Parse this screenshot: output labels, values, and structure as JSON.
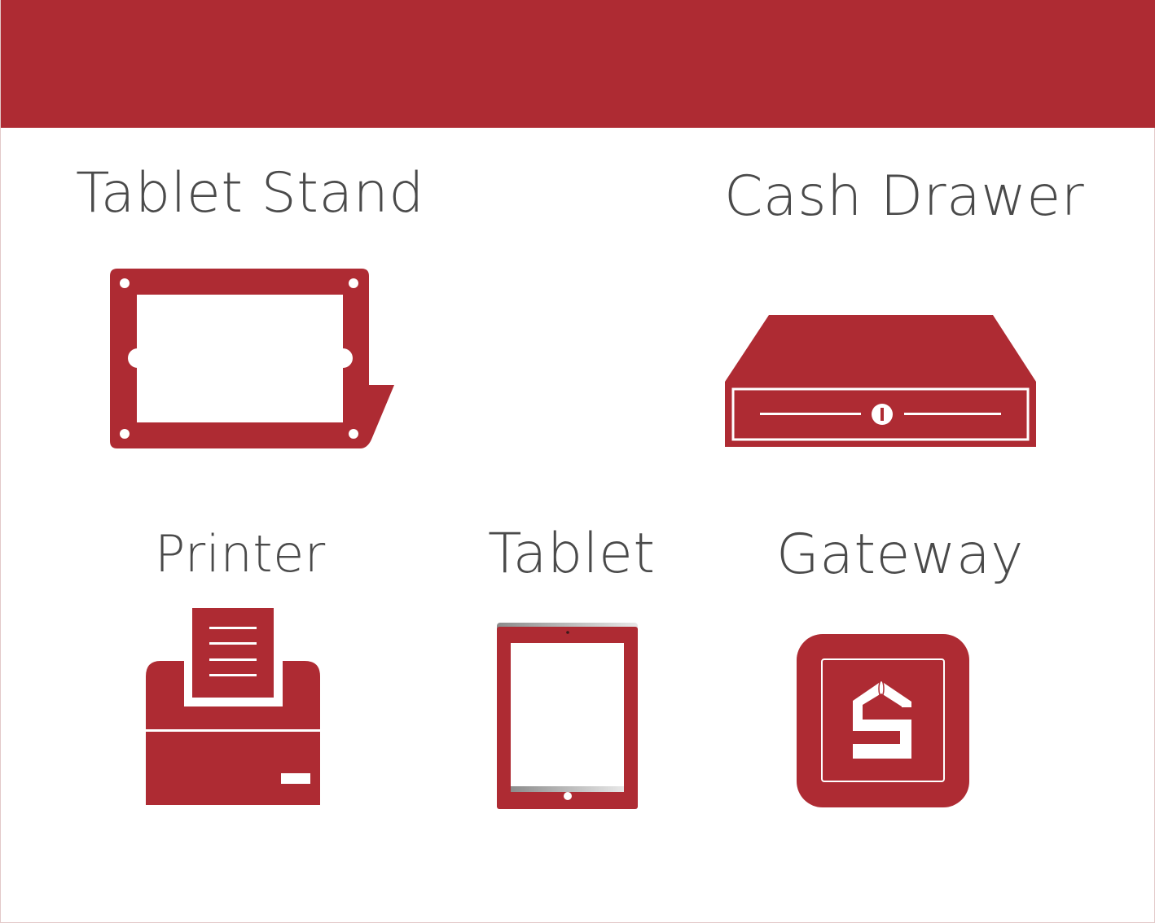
{
  "colors": {
    "accent": "#ae2b33",
    "text": "#4a4a4a",
    "background": "#ffffff"
  },
  "items": {
    "tablet_stand": {
      "label": "Tablet Stand",
      "icon": "tablet-stand-icon"
    },
    "cash_drawer": {
      "label": "Cash Drawer",
      "icon": "cash-drawer-icon"
    },
    "printer": {
      "label": "Printer",
      "icon": "printer-icon"
    },
    "tablet": {
      "label": "Tablet",
      "icon": "tablet-icon"
    },
    "gateway": {
      "label": "Gateway",
      "icon": "gateway-icon"
    }
  }
}
